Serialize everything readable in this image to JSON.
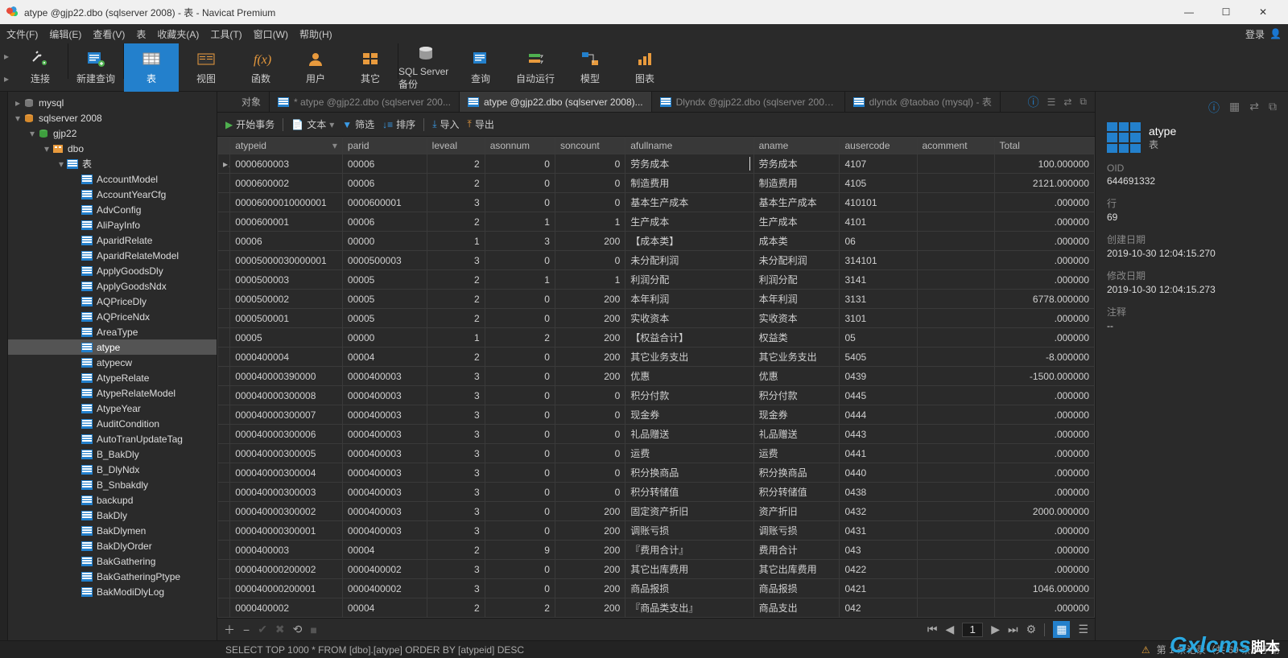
{
  "title": "atype @gjp22.dbo (sqlserver 2008) - 表 - Navicat Premium",
  "menu": [
    "文件(F)",
    "编辑(E)",
    "查看(V)",
    "表",
    "收藏夹(A)",
    "工具(T)",
    "窗口(W)",
    "帮助(H)"
  ],
  "login": "登录",
  "ribbon": [
    {
      "label": "连接",
      "icon": "plug"
    },
    {
      "label": "新建查询",
      "icon": "newquery"
    },
    {
      "label": "表",
      "icon": "table",
      "active": true
    },
    {
      "label": "视图",
      "icon": "view"
    },
    {
      "label": "函数",
      "icon": "fx"
    },
    {
      "label": "用户",
      "icon": "user"
    },
    {
      "label": "其它",
      "icon": "misc"
    },
    {
      "label": "SQL Server 备份",
      "icon": "backup"
    },
    {
      "label": "查询",
      "icon": "query"
    },
    {
      "label": "自动运行",
      "icon": "auto"
    },
    {
      "label": "模型",
      "icon": "model"
    },
    {
      "label": "图表",
      "icon": "chart"
    }
  ],
  "tree": {
    "roots": [
      {
        "label": "mysql",
        "icon": "db-off",
        "indent": 0,
        "twist": "▸"
      },
      {
        "label": "sqlserver 2008",
        "icon": "db-on",
        "indent": 0,
        "twist": "▾"
      },
      {
        "label": "gjp22",
        "icon": "dbgreen",
        "indent": 1,
        "twist": "▾"
      },
      {
        "label": "dbo",
        "icon": "schema",
        "indent": 2,
        "twist": "▾"
      },
      {
        "label": "表",
        "icon": "table",
        "indent": 3,
        "twist": "▾"
      }
    ],
    "tables": [
      "AccountModel",
      "AccountYearCfg",
      "AdvConfig",
      "AliPayInfo",
      "AparidRelate",
      "AparidRelateModel",
      "ApplyGoodsDly",
      "ApplyGoodsNdx",
      "AQPriceDly",
      "AQPriceNdx",
      "AreaType",
      "atype",
      "atypecw",
      "AtypeRelate",
      "AtypeRelateModel",
      "AtypeYear",
      "AuditCondition",
      "AutoTranUpdateTag",
      "B_BakDly",
      "B_DlyNdx",
      "B_Snbakdly",
      "backupd",
      "BakDly",
      "BakDlymen",
      "BakDlyOrder",
      "BakGathering",
      "BakGatheringPtype",
      "BakModiDlyLog"
    ],
    "selected": "atype"
  },
  "tabs": [
    {
      "label": "对象",
      "icon": "none"
    },
    {
      "label": "* atype @gjp22.dbo (sqlserver 200...",
      "icon": "table-blue",
      "dim": true
    },
    {
      "label": "atype @gjp22.dbo (sqlserver 2008)...",
      "icon": "table-blue",
      "active": true
    },
    {
      "label": "Dlyndx @gjp22.dbo (sqlserver 2008...",
      "icon": "table-blue",
      "dim": true
    },
    {
      "label": "dlyndx @taobao (mysql) - 表",
      "icon": "table-blue",
      "dim": true
    }
  ],
  "toolbar": {
    "begin": "开始事务",
    "text": "文本",
    "filter": "筛选",
    "sort": "排序",
    "import": "导入",
    "export": "导出"
  },
  "columns": [
    "atypeid",
    "parid",
    "leveal",
    "asonnum",
    "soncount",
    "afullname",
    "aname",
    "ausercode",
    "acomment",
    "Total"
  ],
  "rows": [
    [
      "0000600003",
      "00006",
      "2",
      "0",
      "0",
      "劳务成本",
      "劳务成本",
      "4107",
      "",
      "100.000000"
    ],
    [
      "0000600002",
      "00006",
      "2",
      "0",
      "0",
      "制造费用",
      "制造费用",
      "4105",
      "",
      "2121.000000"
    ],
    [
      "00006000010000001",
      "0000600001",
      "3",
      "0",
      "0",
      "基本生产成本",
      "基本生产成本",
      "410101",
      "",
      ".000000"
    ],
    [
      "0000600001",
      "00006",
      "2",
      "1",
      "1",
      "生产成本",
      "生产成本",
      "4101",
      "",
      ".000000"
    ],
    [
      "00006",
      "00000",
      "1",
      "3",
      "200",
      "【成本类】",
      "成本类",
      "06",
      "",
      ".000000"
    ],
    [
      "00005000030000001",
      "0000500003",
      "3",
      "0",
      "0",
      "未分配利润",
      "未分配利润",
      "314101",
      "",
      ".000000"
    ],
    [
      "0000500003",
      "00005",
      "2",
      "1",
      "1",
      "利润分配",
      "利润分配",
      "3141",
      "",
      ".000000"
    ],
    [
      "0000500002",
      "00005",
      "2",
      "0",
      "200",
      "本年利润",
      "本年利润",
      "3131",
      "",
      "6778.000000"
    ],
    [
      "0000500001",
      "00005",
      "2",
      "0",
      "200",
      "实收资本",
      "实收资本",
      "3101",
      "",
      ".000000"
    ],
    [
      "00005",
      "00000",
      "1",
      "2",
      "200",
      "【权益合计】",
      "权益类",
      "05",
      "",
      ".000000"
    ],
    [
      "0000400004",
      "00004",
      "2",
      "0",
      "200",
      "其它业务支出",
      "其它业务支出",
      "5405",
      "",
      "-8.000000"
    ],
    [
      "000040000390000",
      "0000400003",
      "3",
      "0",
      "200",
      "优惠",
      "优惠",
      "0439",
      "",
      "-1500.000000"
    ],
    [
      "000040000300008",
      "0000400003",
      "3",
      "0",
      "0",
      "积分付款",
      "积分付款",
      "0445",
      "",
      ".000000"
    ],
    [
      "000040000300007",
      "0000400003",
      "3",
      "0",
      "0",
      "现金券",
      "现金券",
      "0444",
      "",
      ".000000"
    ],
    [
      "000040000300006",
      "0000400003",
      "3",
      "0",
      "0",
      "礼品赠送",
      "礼品赠送",
      "0443",
      "",
      ".000000"
    ],
    [
      "000040000300005",
      "0000400003",
      "3",
      "0",
      "0",
      "运费",
      "运费",
      "0441",
      "",
      ".000000"
    ],
    [
      "000040000300004",
      "0000400003",
      "3",
      "0",
      "0",
      "积分换商品",
      "积分换商品",
      "0440",
      "",
      ".000000"
    ],
    [
      "000040000300003",
      "0000400003",
      "3",
      "0",
      "0",
      "积分转储值",
      "积分转储值",
      "0438",
      "",
      ".000000"
    ],
    [
      "000040000300002",
      "0000400003",
      "3",
      "0",
      "200",
      "固定资产折旧",
      "资产折旧",
      "0432",
      "",
      "2000.000000"
    ],
    [
      "000040000300001",
      "0000400003",
      "3",
      "0",
      "200",
      "调账亏损",
      "调账亏损",
      "0431",
      "",
      ".000000"
    ],
    [
      "0000400003",
      "00004",
      "2",
      "9",
      "200",
      "『费用合计』",
      "费用合计",
      "043",
      "",
      ".000000"
    ],
    [
      "000040000200002",
      "0000400002",
      "3",
      "0",
      "200",
      "其它出库费用",
      "其它出库费用",
      "0422",
      "",
      ".000000"
    ],
    [
      "000040000200001",
      "0000400002",
      "3",
      "0",
      "200",
      "商品报损",
      "商品报损",
      "0421",
      "",
      "1046.000000"
    ],
    [
      "0000400002",
      "00004",
      "2",
      "2",
      "200",
      "『商品类支出』",
      "商品支出",
      "042",
      "",
      ".000000"
    ]
  ],
  "editingRow": 0,
  "gridfooter": {
    "page": "1"
  },
  "right": {
    "name": "atype",
    "type": "表",
    "fields": [
      {
        "lbl": "OID",
        "val": "644691332"
      },
      {
        "lbl": "行",
        "val": "69"
      },
      {
        "lbl": "创建日期",
        "val": "2019-10-30 12:04:15.270"
      },
      {
        "lbl": "修改日期",
        "val": "2019-10-30 12:04:15.273"
      },
      {
        "lbl": "注释",
        "val": "--"
      }
    ]
  },
  "status": {
    "query": "SELECT TOP 1000 * FROM [dbo].[atype] ORDER BY [atypeid] DESC",
    "record": "第 1 条记录（共 69 条）于第"
  },
  "watermark": {
    "a": "Gxlcms",
    "b": "脚本"
  }
}
